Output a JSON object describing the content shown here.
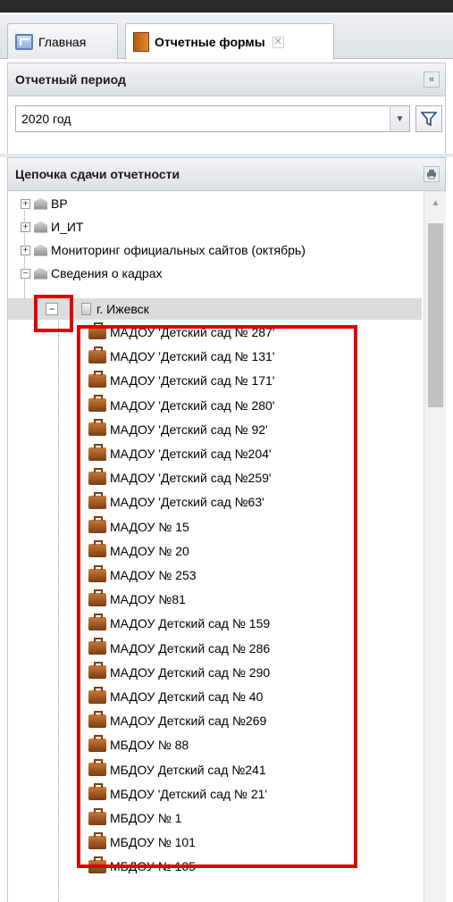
{
  "tabs": [
    {
      "label": "Главная",
      "icon": "home-icon"
    },
    {
      "label": "Отчетные формы",
      "icon": "report-forms-icon",
      "close_label": "✕"
    }
  ],
  "period_panel": {
    "title": "Отчетный период",
    "collapse_label": "«",
    "selected_period": "2020 год"
  },
  "chain_panel": {
    "title": "Цепочка сдачи отчетности",
    "top_nodes": [
      {
        "label": "ВР",
        "expanded": false
      },
      {
        "label": "И_ИТ",
        "expanded": false
      },
      {
        "label": "Мониторинг официальных сайтов (октябрь)",
        "expanded": false
      },
      {
        "label": "Сведения о кадрах",
        "expanded": true
      }
    ],
    "city_node": {
      "label": "г. Ижевск",
      "expanded": true
    },
    "children": [
      "МАДОУ 'Детский сад № 287'",
      "МАДОУ 'Детский сад № 131'",
      "МАДОУ 'Детский сад № 171'",
      "МАДОУ 'Детский сад № 280'",
      "МАДОУ 'Детский сад № 92'",
      "МАДОУ 'Детский сад №204'",
      "МАДОУ 'Детский сад №259'",
      "МАДОУ 'Детский сад №63'",
      "МАДОУ № 15",
      "МАДОУ № 20",
      "МАДОУ № 253",
      "МАДОУ №81",
      "МАДОУ Детский сад № 159",
      "МАДОУ Детский сад № 286",
      "МАДОУ Детский сад № 290",
      "МАДОУ Детский сад № 40",
      "МАДОУ Детский сад №269",
      "МБДОУ № 88",
      "МБДОУ Детский сад №241",
      "МБДОУ 'Детский сад № 21'",
      "МБДОУ № 1",
      "МБДОУ № 101",
      "МБДОУ № 105"
    ]
  },
  "colors": {
    "highlight": "#e00000",
    "selected_row": "#dcdcdc"
  }
}
